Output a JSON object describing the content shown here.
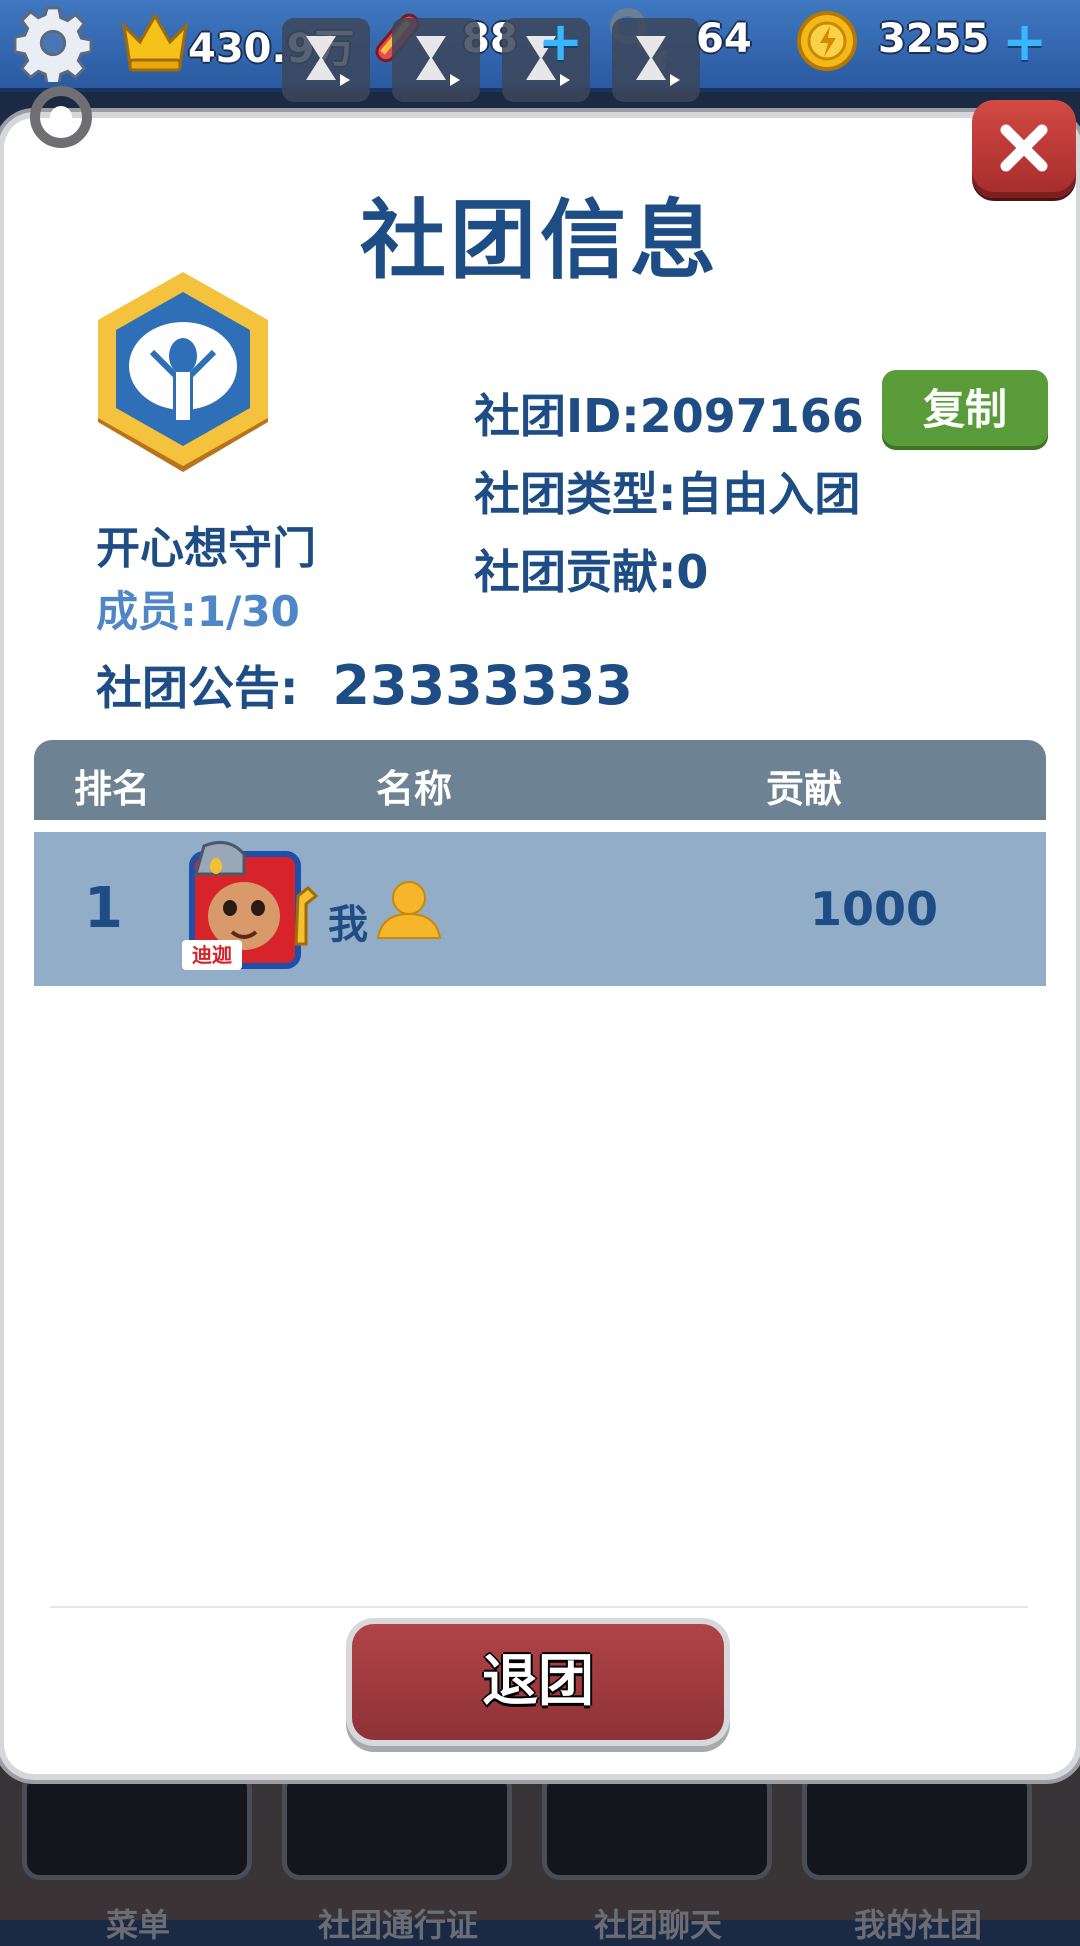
{
  "hud": {
    "crown_value": "430.9万",
    "shoes_value": "88",
    "keys_value": "64",
    "coins_value": "3255"
  },
  "dialog": {
    "title": "社团信息",
    "club": {
      "name": "开心想守门",
      "members": "成员:1/30",
      "id_label": "社团ID:2097166",
      "type_label": "社团类型:自由入团",
      "contribution_label": "社团贡献:0",
      "notice_label": "社团公告:",
      "notice_value": "23333333"
    },
    "copy_button": "复制",
    "table": {
      "headers": [
        "排名",
        "名称",
        "贡献"
      ],
      "rows": [
        {
          "rank": "1",
          "avatar_text": "迪迦",
          "name": "我",
          "contribution": "1000"
        }
      ]
    },
    "leave_button": "退团"
  },
  "bottom_nav": {
    "items": [
      "菜单",
      "社团通行证",
      "社团聊天",
      "我的社团"
    ]
  },
  "colors": {
    "title_blue": "#1d4d84",
    "member_blue": "#4f86c5",
    "copy_green": "#5a9b3a",
    "leave_red": "#a53c40",
    "close_red": "#c13c38",
    "table_header": "#6d8394",
    "table_row": "#91adc7"
  }
}
